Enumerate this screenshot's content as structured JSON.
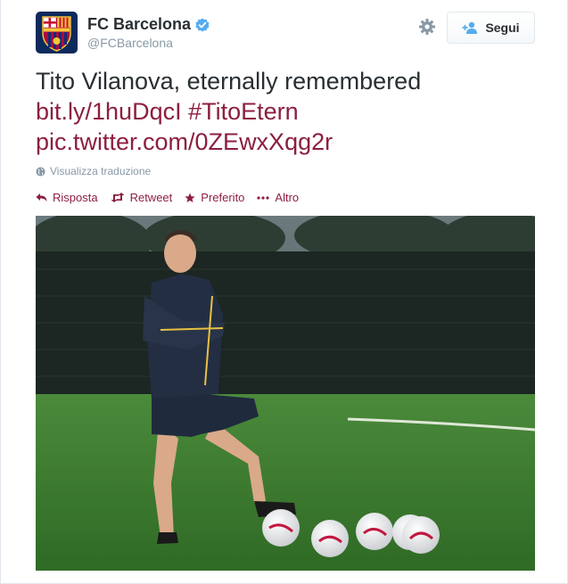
{
  "user": {
    "display_name": "FC Barcelona",
    "handle": "@FCBarcelona",
    "verified": true,
    "avatar_icon": "fc-barcelona-crest"
  },
  "follow_button": {
    "label": "Segui",
    "icon": "add-user-icon"
  },
  "tweet": {
    "text": "Tito Vilanova, eternally remembered",
    "link": "bit.ly/1huDqcI",
    "hashtag": "#TitoEtern",
    "pic_link": "pic.twitter.com/0ZEwxXqg2r"
  },
  "translate_label": "Visualizza traduzione",
  "actions": [
    {
      "label": "Risposta",
      "icon": "reply-icon"
    },
    {
      "label": "Retweet",
      "icon": "retweet-icon"
    },
    {
      "label": "Preferito",
      "icon": "star-icon"
    },
    {
      "label": "Altro",
      "icon": "more-dots-icon"
    }
  ],
  "colors": {
    "link": "#8c1f3f",
    "muted": "#8899a6",
    "text": "#292f33",
    "verified": "#55acee",
    "follow_icon": "#55acee"
  }
}
